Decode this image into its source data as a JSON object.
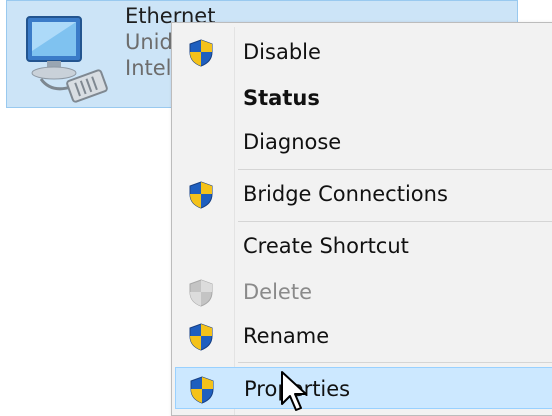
{
  "adapter": {
    "name": "Ethernet",
    "line2": "Unid",
    "line3": "Intel",
    "icon": "network-adapter-icon"
  },
  "menu": {
    "items": [
      {
        "label": "Disable",
        "shield": true
      },
      {
        "label": "Status",
        "shield": false,
        "bold": true
      },
      {
        "label": "Diagnose",
        "shield": false
      },
      {
        "label": "Bridge Connections",
        "shield": true
      },
      {
        "label": "Create Shortcut",
        "shield": false
      },
      {
        "label": "Delete",
        "shield": true,
        "disabled": true
      },
      {
        "label": "Rename",
        "shield": true
      },
      {
        "label": "Properties",
        "shield": true,
        "hover": true
      }
    ]
  },
  "colors": {
    "selection": "#cce4f7",
    "menu_bg": "#f2f2f2",
    "hover": "#cce8ff",
    "shield_blue": "#1f5fbf",
    "shield_yellow": "#f4c21a"
  },
  "cursor": "arrow-pointer-icon"
}
